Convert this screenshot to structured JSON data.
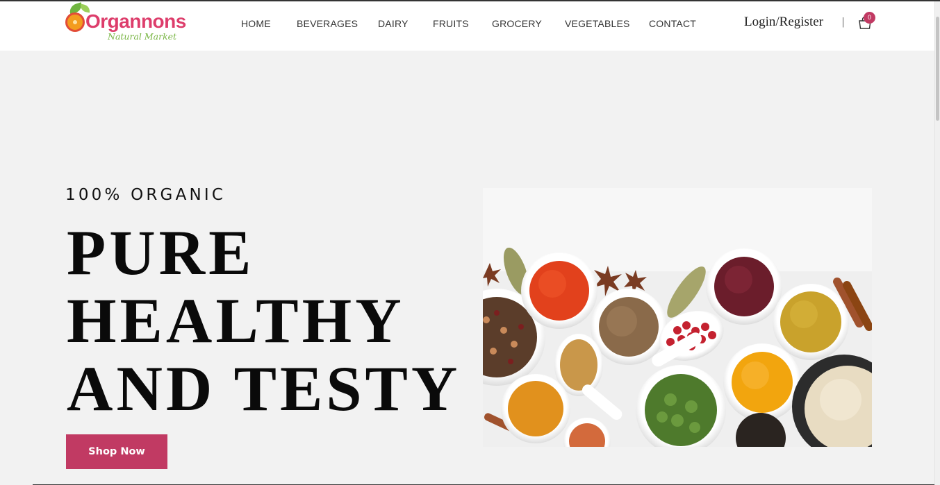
{
  "brand": {
    "name": "Organnons",
    "tagline": "Natural Market"
  },
  "nav": {
    "items": [
      {
        "label": "HOME"
      },
      {
        "label": "BEVERAGES"
      },
      {
        "label": "DAIRY"
      },
      {
        "label": "FRUITS"
      },
      {
        "label": "GROCERY"
      },
      {
        "label": "VEGETABLES"
      },
      {
        "label": "CONTACT"
      }
    ]
  },
  "account": {
    "login_label": "Login/Register",
    "separator": "|",
    "cart_icon": "shopping-bag-icon",
    "cart_count": "0"
  },
  "hero": {
    "eyebrow": "100% ORGANIC",
    "headline_lines": [
      "PURE",
      "HEALTHY",
      "AND TESTY"
    ],
    "cta_label": "Shop Now",
    "image_subject": "spices-in-bowls"
  },
  "colors": {
    "accent": "#c13a63",
    "background": "#f2f2f2",
    "header_bg": "#ffffff",
    "logo_green": "#78b543",
    "logo_pink": "#dd3d6b"
  }
}
